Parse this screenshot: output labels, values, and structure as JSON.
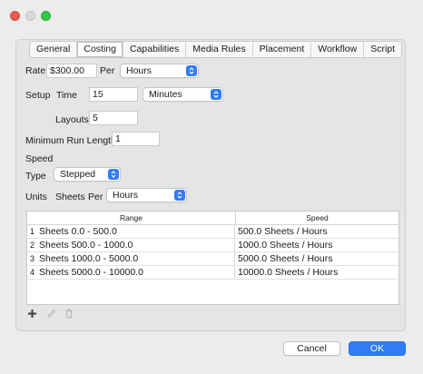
{
  "tabs": [
    "General",
    "Costing",
    "Capabilities",
    "Media Rules",
    "Placement",
    "Workflow",
    "Script"
  ],
  "active_tab": "Costing",
  "rate": {
    "label": "Rate",
    "value": "$300.00",
    "per_label": "Per",
    "unit": "Hours"
  },
  "setup": {
    "label": "Setup",
    "time_label": "Time",
    "time_value": "15",
    "time_unit": "Minutes",
    "layouts_label": "Layouts",
    "layouts_value": "5"
  },
  "min_run": {
    "label": "Minimum Run Length",
    "value": "1"
  },
  "speed": {
    "section_label": "Speed",
    "type_label": "Type",
    "type_value": "Stepped",
    "units_label": "Units",
    "units_sheets": "Sheets",
    "units_per": "Per",
    "units_value": "Hours"
  },
  "table": {
    "columns": [
      "Range",
      "Speed"
    ],
    "rows": [
      {
        "n": "1",
        "range": "Sheets 0.0 - 500.0",
        "speed": "500.0 Sheets / Hours"
      },
      {
        "n": "2",
        "range": "Sheets 500.0 - 1000.0",
        "speed": "1000.0 Sheets / Hours"
      },
      {
        "n": "3",
        "range": "Sheets 1000.0 - 5000.0",
        "speed": "5000.0 Sheets / Hours"
      },
      {
        "n": "4",
        "range": "Sheets 5000.0 - 10000.0",
        "speed": "10000.0 Sheets / Hours"
      }
    ]
  },
  "toolbar_icons": [
    "plus-icon",
    "pencil-icon",
    "trash-icon"
  ],
  "buttons": {
    "cancel": "Cancel",
    "ok": "OK"
  },
  "colors": {
    "accent": "#2f7cf6",
    "close": "#ee5a52",
    "maximize": "#33c748"
  }
}
